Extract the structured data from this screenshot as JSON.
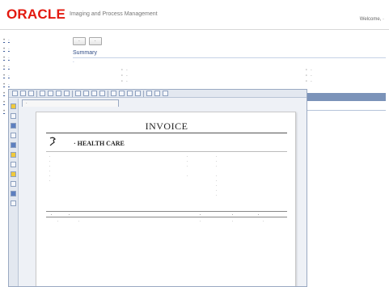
{
  "header": {
    "logo": "ORACLE",
    "product": "Imaging and Process Management",
    "welcome": "Welcome, ·"
  },
  "sidebar": {
    "items": [
      {
        "label": "·"
      },
      {
        "label": "·"
      },
      {
        "label": "·"
      },
      {
        "label": "·"
      },
      {
        "label": "·"
      },
      {
        "label": "·"
      },
      {
        "label": "·"
      },
      {
        "label": "·"
      },
      {
        "label": "·"
      }
    ]
  },
  "main": {
    "buttons": [
      "·",
      "·"
    ],
    "section_title": "Summary",
    "subtitle": "·",
    "fields_left": [
      {
        "label": "·",
        "value": "·"
      },
      {
        "label": "·",
        "value": "·"
      },
      {
        "label": "·",
        "value": "·"
      }
    ],
    "fields_right": [
      {
        "label": "·",
        "value": "·"
      },
      {
        "label": "·",
        "value": "·"
      },
      {
        "label": "·",
        "value": "·"
      }
    ],
    "tabs": [
      "·",
      "·",
      "·",
      "·",
      "·"
    ],
    "subtab": "·"
  },
  "viewer": {
    "document_tab": "·",
    "invoice": {
      "title": "INVOICE",
      "company": "· HEALTH CARE",
      "address_lines": [
        "·",
        "·",
        "·",
        "·",
        "·",
        "·"
      ],
      "meta_labels": [
        "·",
        "·",
        "·",
        "",
        "·"
      ],
      "meta_values": [
        "·",
        "·",
        "·",
        "",
        "·",
        "·",
        "·",
        "·",
        "·"
      ],
      "table_headers": [
        "·",
        "·",
        "·",
        "·",
        "·"
      ],
      "table_row": [
        "·",
        "·",
        "·",
        "·",
        "·"
      ]
    }
  }
}
